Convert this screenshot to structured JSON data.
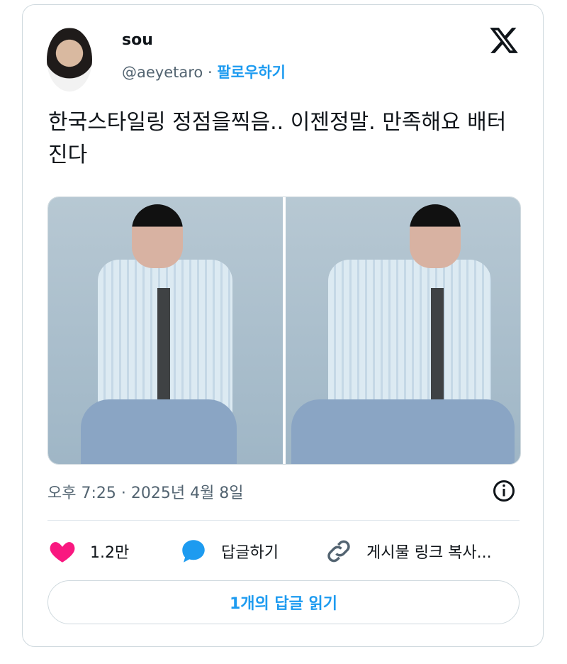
{
  "post": {
    "author": {
      "name": "sou",
      "handle": "@aeyetaro",
      "separator": "·",
      "follow": "팔로우하기"
    },
    "text": "한국스타일링 정점을찍음.. 이젠정말. 만족해요 배터진다",
    "timestamp": "오후 7:25 · 2025년 4월 8일",
    "actions": {
      "like_count": "1.2만",
      "reply_label": "답글하기",
      "copy_label": "게시물 링크 복사..."
    },
    "read_replies": "1개의 답글 읽기"
  },
  "colors": {
    "accent": "#1d9bf0",
    "like": "#f91880",
    "text": "#0f1419",
    "muted": "#536471"
  },
  "icons": [
    "x-logo-icon",
    "info-icon",
    "heart-icon",
    "reply-icon",
    "link-icon"
  ]
}
